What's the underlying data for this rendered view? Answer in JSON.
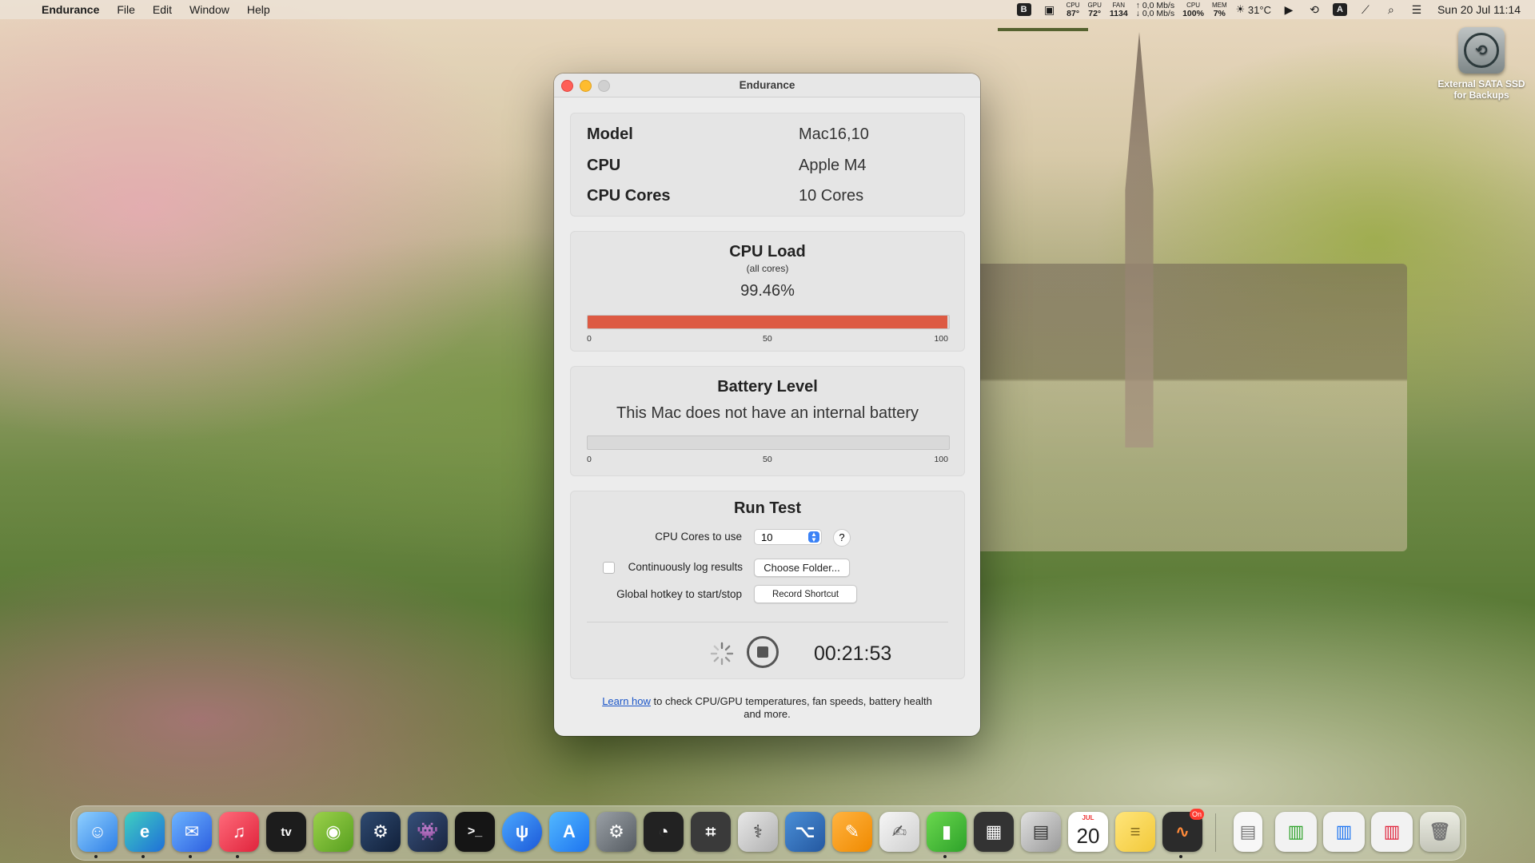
{
  "menubar": {
    "app_name": "Endurance",
    "menus": [
      "File",
      "Edit",
      "Window",
      "Help"
    ],
    "stats": {
      "cpu_temp_label": "CPU",
      "cpu_temp": "87°",
      "gpu_temp_label": "GPU",
      "gpu_temp": "72°",
      "fan_label": "FAN",
      "fan": "1134",
      "net_up": "↑ 0,0 Mb/s",
      "net_down": "↓ 0,0 Mb/s",
      "cpu_label": "CPU",
      "cpu": "100%",
      "mem_label": "MEM",
      "mem": "7%"
    },
    "temperature": "31°C",
    "input_source": "A",
    "clock": "Sun 20 Jul  11:14"
  },
  "desktop": {
    "drive_label": "External SATA SSD for Backups"
  },
  "window": {
    "title": "Endurance",
    "info": [
      {
        "key": "Model",
        "value": "Mac16,10"
      },
      {
        "key": "CPU",
        "value": "Apple M4"
      },
      {
        "key": "CPU Cores",
        "value": "10 Cores"
      }
    ],
    "cpu_load": {
      "title": "CPU Load",
      "subtitle": "(all cores)",
      "value_text": "99.46%",
      "value": 99.46,
      "ticks": [
        "0",
        "50",
        "100"
      ]
    },
    "battery": {
      "title": "Battery Level",
      "message": "This Mac does not have an internal battery",
      "value": 0,
      "ticks": [
        "0",
        "50",
        "100"
      ]
    },
    "run_test": {
      "title": "Run Test",
      "cores_label": "CPU Cores to use",
      "cores_value": "10",
      "help": "?",
      "log_label": "Continuously log results",
      "log_checked": false,
      "choose_folder": "Choose Folder...",
      "hotkey_label": "Global hotkey to start/stop",
      "record_shortcut": "Record Shortcut",
      "timer": "00:21:53"
    },
    "footer": {
      "link": "Learn how",
      "text": " to check CPU/GPU temperatures, fan speeds, battery health and more."
    }
  },
  "dock": {
    "calendar_month": "JUL",
    "calendar_day": "20",
    "activity_badge": "On"
  },
  "colors": {
    "load_bar": "#dd5a43",
    "window_bg": "#ececec",
    "link": "#1a55c8"
  }
}
